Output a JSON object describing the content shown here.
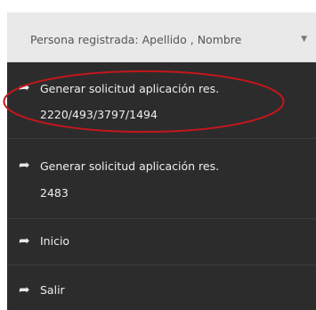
{
  "header": {
    "label": "Persona registrada: Apellido , Nombre",
    "caret": "▼"
  },
  "menu": {
    "items": [
      {
        "icon": "share-arrow-icon",
        "line1": "Generar solicitud aplicación res.",
        "line2": "2220/493/3797/1494"
      },
      {
        "icon": "share-arrow-icon",
        "line1": "Generar solicitud aplicación res.",
        "line2": "2483"
      },
      {
        "icon": "share-arrow-icon",
        "line1": "Inicio"
      },
      {
        "icon": "share-arrow-icon",
        "line1": "Salir"
      }
    ]
  },
  "colors": {
    "menu_bg": "#2c2c2c",
    "header_bg": "#e9e9e9",
    "highlight_ellipse": "#c4161c"
  }
}
